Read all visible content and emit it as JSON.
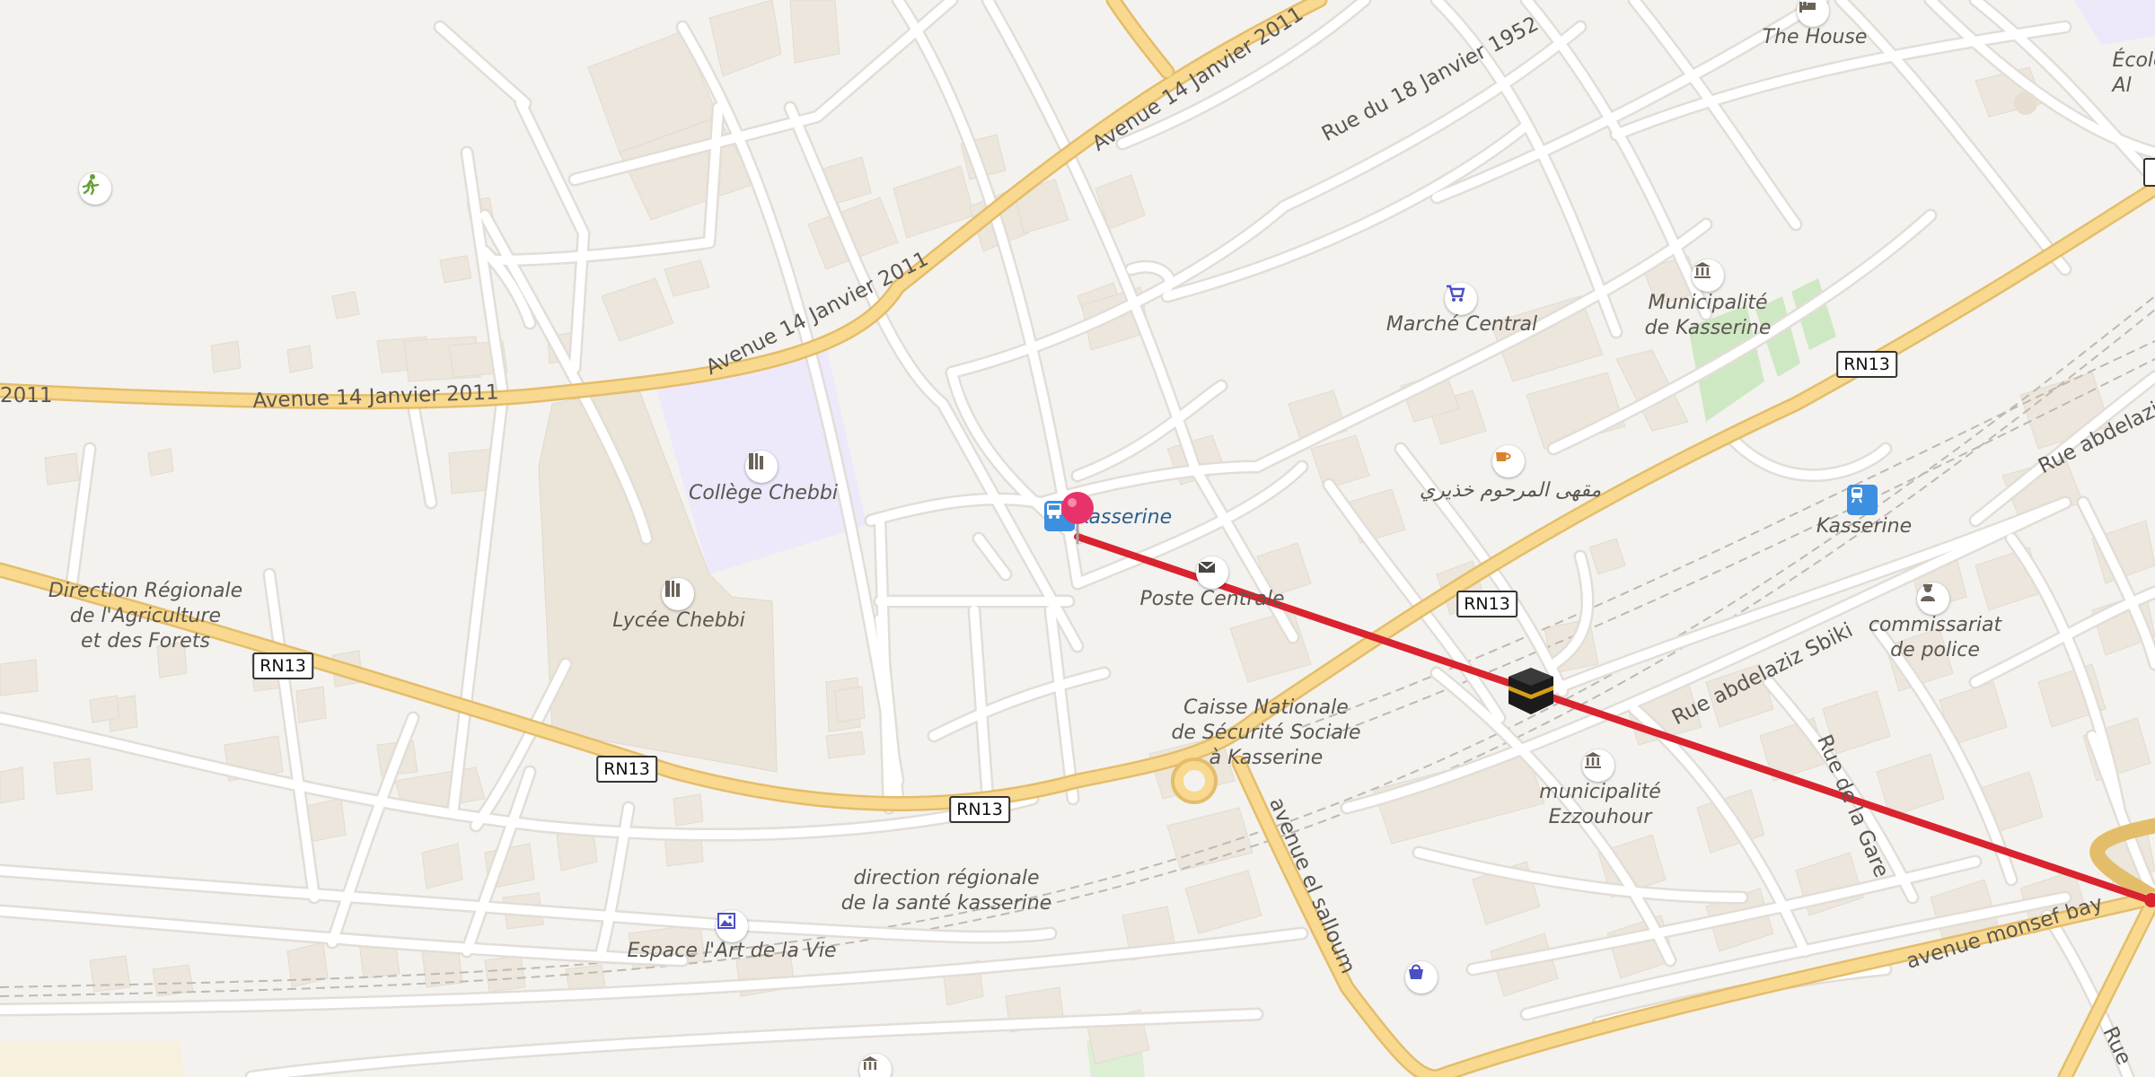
{
  "map": {
    "colors": {
      "background": "#f4f2ef",
      "main_road": "#f8d98f",
      "main_road_casing": "#e8c06a",
      "minor_road": "#ffffff",
      "building": "#ece6dc",
      "school_area": "#ede8fa",
      "green": "#cfe8c4",
      "route": "#d9232e",
      "pin": "#e8336a"
    },
    "road_labels": {
      "av14_a": "Avenue 14 Janvier 2011",
      "av14_b": "Avenue 14 Janvier 2011",
      "av14_c": "Avenue 14 Janvier 2011",
      "av14_edge": "2011",
      "rue18": "Rue du 18 Janvier 1952",
      "sbiki": "Rue abdelaziz Sbiki",
      "abdelaziz": "Rue abdelaziz",
      "salloum": "avenue el salloum",
      "gare": "Rue de la Gare",
      "monsef": "avenue monsef bay",
      "rue_edge": "Rue"
    },
    "shields": [
      "RN13",
      "RN13",
      "RN13",
      "RN13",
      "RN13"
    ],
    "places": {
      "college": "Collège Chebbi",
      "lycee": "Lycée Chebbi",
      "direction_agri": "Direction Régionale\nde l'Agriculture\net des Forets",
      "marche": "Marché Central",
      "municipalite": "Municipalité\nde Kasserine",
      "cafe": "مقهى المرحوم خذيري",
      "bus_station": "Kasserine",
      "poste": "Poste Centrale",
      "cnss": "Caisse Nationale\nde Sécurité Sociale\nà Kasserine",
      "train_station": "Kasserine",
      "commissariat": "commissariat\nde police",
      "municipalite_ezz": "municipalité\nEzzouhour",
      "sante": "direction régionale\nde la santé kasserine",
      "espace": "Espace l'Art de la Vie",
      "the_house": "The House",
      "ecole": "École\nAl"
    },
    "icons": {
      "sport": "running-icon",
      "college": "school-icon",
      "lycee": "school-icon",
      "marche": "shopping-cart-icon",
      "municipalite": "townhall-icon",
      "cafe": "cafe-icon",
      "bus": "bus-icon",
      "pin": "location-pin-icon",
      "poste": "mail-icon",
      "kaaba": "kaaba-icon",
      "train": "train-icon",
      "police": "police-icon",
      "municipalite_ezz": "townhall-icon",
      "espace": "gallery-icon",
      "bag": "shopping-bag-icon",
      "hotel": "hotel-icon"
    }
  }
}
